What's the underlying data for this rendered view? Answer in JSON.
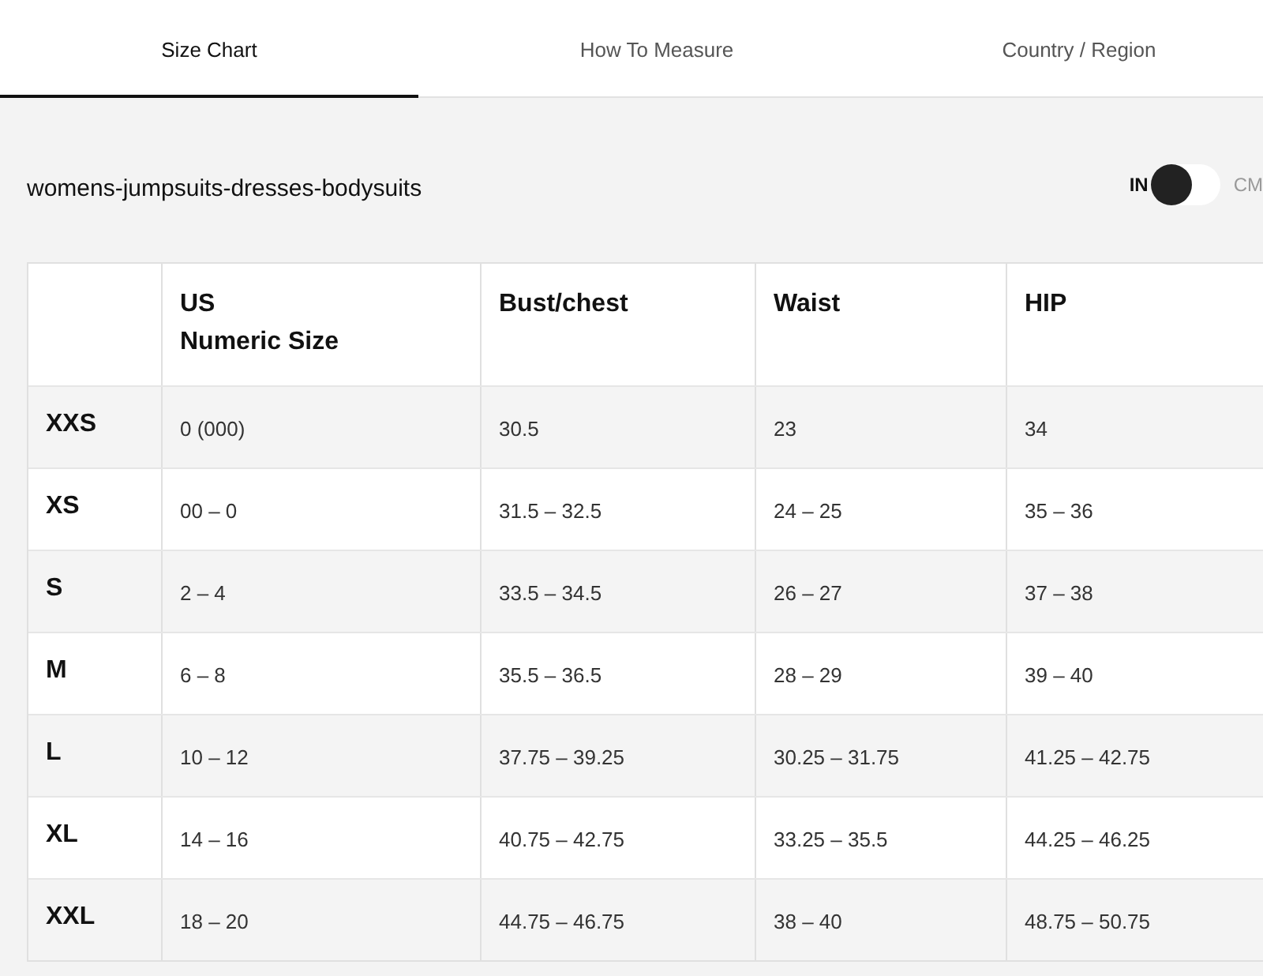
{
  "tabs": [
    {
      "label": "Size Chart",
      "selected": true
    },
    {
      "label": "How To Measure",
      "selected": false
    },
    {
      "label": "Country / Region",
      "selected": false
    }
  ],
  "chart_title": "womens-jumpsuits-dresses-bodysuits",
  "unit_switch": {
    "left_label": "IN",
    "right_label": "CM",
    "on": false
  },
  "table": {
    "columns": [
      "",
      "US\nNumeric Size",
      "Bust/chest",
      "Waist",
      "HIP"
    ],
    "rows": [
      [
        "XXS",
        "0 (000)",
        "30.5",
        "23",
        "34"
      ],
      [
        "XS",
        "00 – 0",
        "31.5 – 32.5",
        "24 – 25",
        "35 – 36"
      ],
      [
        "S",
        "2 – 4",
        "33.5 – 34.5",
        "26 – 27",
        "37 – 38"
      ],
      [
        "M",
        "6 – 8",
        "35.5 – 36.5",
        "28 – 29",
        "39 – 40"
      ],
      [
        "L",
        "10 – 12",
        "37.75 – 39.25",
        "30.25 – 31.75",
        "41.25 – 42.75"
      ],
      [
        "XL",
        "14 – 16",
        "40.75 – 42.75",
        "33.25 – 35.5",
        "44.25 – 46.25"
      ],
      [
        "XXL",
        "18 – 20",
        "44.75 – 46.75",
        "38 – 40",
        "48.75 – 50.75"
      ]
    ]
  }
}
